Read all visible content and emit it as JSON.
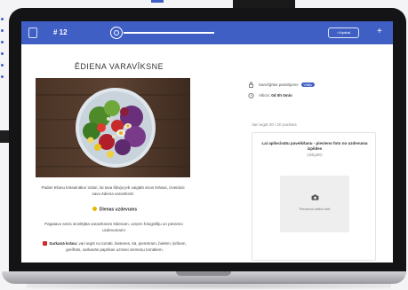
{
  "topbar": {
    "day_label": "# 12",
    "back_label": "‹ Atpakaļ",
    "progress": 1.0,
    "accent_color": "#3f5fc4"
  },
  "left": {
    "title": "ĒDIENA VARAVĪKSNE",
    "photo_alt": "Salad bowl on wooden table",
    "intro": "Padari ēšanu krāsaināku! Izdari, lai tava šķīvja jeb vaigālā visos krāsas, izveidosi savu ēdiena varavīksni!",
    "section_title": "Dienas uzdevums",
    "section_text": "Pagatavo sevis iecelējāta varavīksnes ēdienam, uzņem fotogrāfiju un pievieno uzdevumam!",
    "recipe_label": "Sarkanā krāsa:",
    "recipe_text": "vari iegūt no tomāti, bietenes, kā, piemēram, bietēm, ķiršiem, greifrūts, sarkanās paprikas uzsīvei ziemeņu tomātiem."
  },
  "right": {
    "difficulty_label": "Sarežģītas pasūtījums",
    "difficulty_badge": "Vidējs",
    "time_label": "Atlicis:",
    "time_value": "0d 0h 0min",
    "points_text": "Vari iegūt 20 / 20 punktus",
    "upload_title": "Lai apliecinātu paveikšanu - pievieno foto no uzdevuma izpildes",
    "upload_sub": "(obligāts)",
    "upload_button": "Pievienot attēlu šeit"
  }
}
